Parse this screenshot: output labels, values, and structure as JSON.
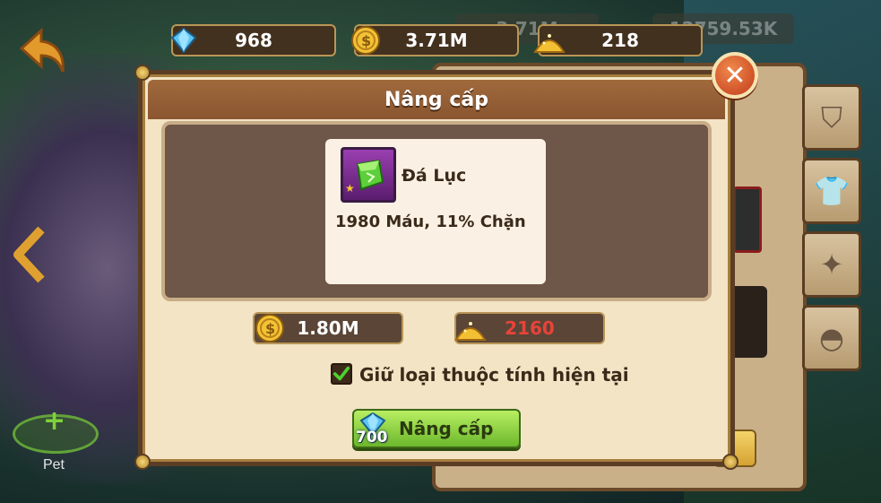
{
  "currency": {
    "gems": "968",
    "gold": "3.71M",
    "dust": "218",
    "ghost_gold": "3.71M",
    "ghost_other": "12759.53K"
  },
  "side": {
    "pet_label": "Pet"
  },
  "dialog": {
    "title": "Nâng cấp",
    "close_symbol": "✕",
    "item": {
      "name": "Đá Lục",
      "stats": "1980 Máu, 11% Chặn"
    },
    "cost_gold": "1.80M",
    "cost_dust": "2160",
    "keep_attribute_label": "Giữ loại thuộc tính hiện tại",
    "keep_attribute_checked": true,
    "upgrade_button_label": "Nâng cấp",
    "upgrade_gem_cost": "700"
  },
  "colors": {
    "dust_cost_insufficient": "#e8433a",
    "button_green": "#8ad43e",
    "header_brown": "#95603a"
  },
  "icons": {
    "back": "back-arrow-icon",
    "gem": "blue-gem-icon",
    "gold": "gold-coin-icon",
    "dust": "gold-dust-icon",
    "close": "close-icon",
    "item": "green-stone-icon",
    "check": "checkmark-icon"
  }
}
